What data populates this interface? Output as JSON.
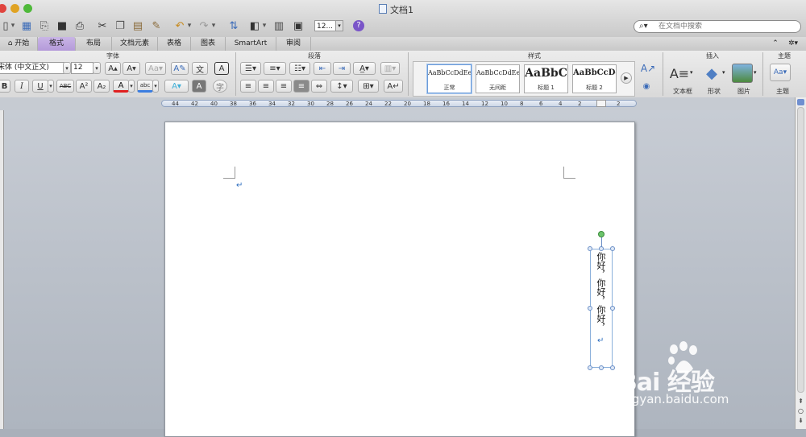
{
  "window": {
    "title": "文档1"
  },
  "toolbar": {
    "zoom_value": "12...",
    "help_label": "?"
  },
  "search": {
    "placeholder": "在文档中搜索"
  },
  "tabs": [
    {
      "label": "开始"
    },
    {
      "label": "格式"
    },
    {
      "label": "布局"
    },
    {
      "label": "文档元素"
    },
    {
      "label": "表格"
    },
    {
      "label": "图表"
    },
    {
      "label": "SmartArt"
    },
    {
      "label": "审阅"
    }
  ],
  "ribbon": {
    "groups": {
      "font": "字体",
      "paragraph": "段落",
      "styles": "样式",
      "insert": "插入",
      "theme": "主题"
    },
    "font_name": "宋体 (中文正文)",
    "font_size": "12",
    "styles": [
      {
        "sample": "AaBbCcDdEe",
        "caption": "正常"
      },
      {
        "sample": "AaBbCcDdEe",
        "caption": "无间距"
      },
      {
        "sample": "AaBbC",
        "caption": "标题 1"
      },
      {
        "sample": "AaBbCcDd",
        "caption": "标题 2"
      }
    ],
    "insert_items": [
      {
        "label": "文本框"
      },
      {
        "label": "形状"
      },
      {
        "label": "图片"
      }
    ],
    "theme_label": "主题",
    "bold": "B",
    "italic": "I",
    "underline": "U",
    "strike": "ABC",
    "superscript": "A²",
    "subscript": "A₂",
    "font_color": "A",
    "char_shade": "A",
    "phonetic": "文",
    "border_char": "A",
    "enclose": "字"
  },
  "ruler": {
    "ticks": [
      "44",
      "42",
      "40",
      "38",
      "36",
      "34",
      "32",
      "30",
      "28",
      "26",
      "24",
      "22",
      "20",
      "18",
      "16",
      "14",
      "12",
      "10",
      "8",
      "6",
      "4",
      "2",
      "",
      "2"
    ]
  },
  "document": {
    "textbox_text": "你好，你好，你好，"
  },
  "watermark": {
    "brand": "Bai  经验",
    "url": "jingyan.baidu.com"
  },
  "colors": {
    "tab_active": "#b49ad9",
    "rotate_handle": "#6cc46c",
    "selection": "#6a8ec6",
    "help": "#7a55c8"
  }
}
